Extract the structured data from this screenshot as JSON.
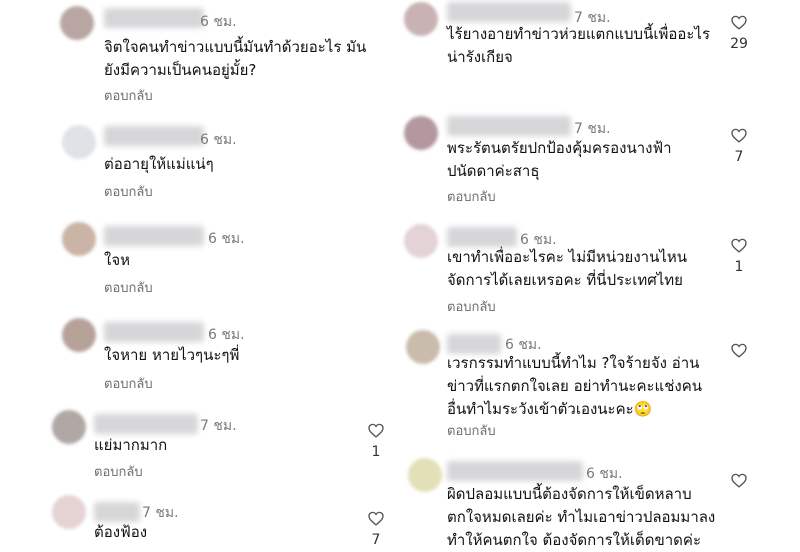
{
  "reply_label": "ตอบกลับ",
  "left": [
    {
      "time": "6 ชม.",
      "text": "จิตใจคนทำข่าวแบบนี้มันทำด้วยอะไร มัน\nยังมีความเป็นคนอยู่มั้ย?",
      "likes": "",
      "avatar_color": "#b9a6a3"
    },
    {
      "time": "6 ชม.",
      "text": "ต่ออายุให้แม่แน่ๆ",
      "likes": "",
      "avatar_color": "#dfe2e7"
    },
    {
      "time": "6 ชม.",
      "text": "ใจห",
      "likes": "",
      "avatar_color": "#c9b4a6"
    },
    {
      "time": "6 ชม.",
      "text": "ใจหาย หายไวๆนะๆพี่",
      "likes": "",
      "avatar_color": "#b7a29a"
    },
    {
      "time": "7 ชม.",
      "text": "แย่มากมาก",
      "likes": "1",
      "avatar_color": "#b0a8a5"
    },
    {
      "time": "7 ชม.",
      "text": "ต้องฟ้อง",
      "likes": "7",
      "avatar_color": "#e5d3d3"
    }
  ],
  "right": [
    {
      "time": "7 ชม.",
      "text": "ไร้ยางอายทำข่าวห่วยแตกแบบนี้เพื่ออะไร\nน่ารังเกียจ",
      "likes": "29",
      "avatar_color": "#c8b2b4"
    },
    {
      "time": "7 ชม.",
      "text": "พระรัตนตรัยปกป้องคุ้มครองนางฟ้า\nปนัดดาค่ะสาธุ",
      "likes": "7",
      "avatar_color": "#b3989e"
    },
    {
      "time": "6 ชม.",
      "text": "เขาทำเพื่ออะไรคะ ไม่มีหน่วยงานไหน\nจัดการได้เลยเหรอคะ ที่นี่ประเทศไทย",
      "likes": "1",
      "avatar_color": "#e3d3d6"
    },
    {
      "time": "6 ชม.",
      "text": "เวรกรรมทำแบบนี้ทำไม ?ใจร้ายจัง อ่าน\nข่าวที่แรกตกใจเลย อย่าทำนะคะแช่งคน\nอื่นทำไมระวังเข้าตัวเองนะคะ🙄",
      "likes": "",
      "avatar_color": "#c9bcaa"
    },
    {
      "time": "6 ชม.",
      "text": "ผิดปลอมแบบนี้ต้องจัดการให้เข็ดหลาบ\nตกใจหมดเลยค่ะ ทำไมเอาข่าวปลอมมาลง\nทำให้คนตกใจ ต้องจัดการให้เด็ดขาดค่ะ",
      "likes": "",
      "avatar_color": "#e3e0b8"
    }
  ]
}
